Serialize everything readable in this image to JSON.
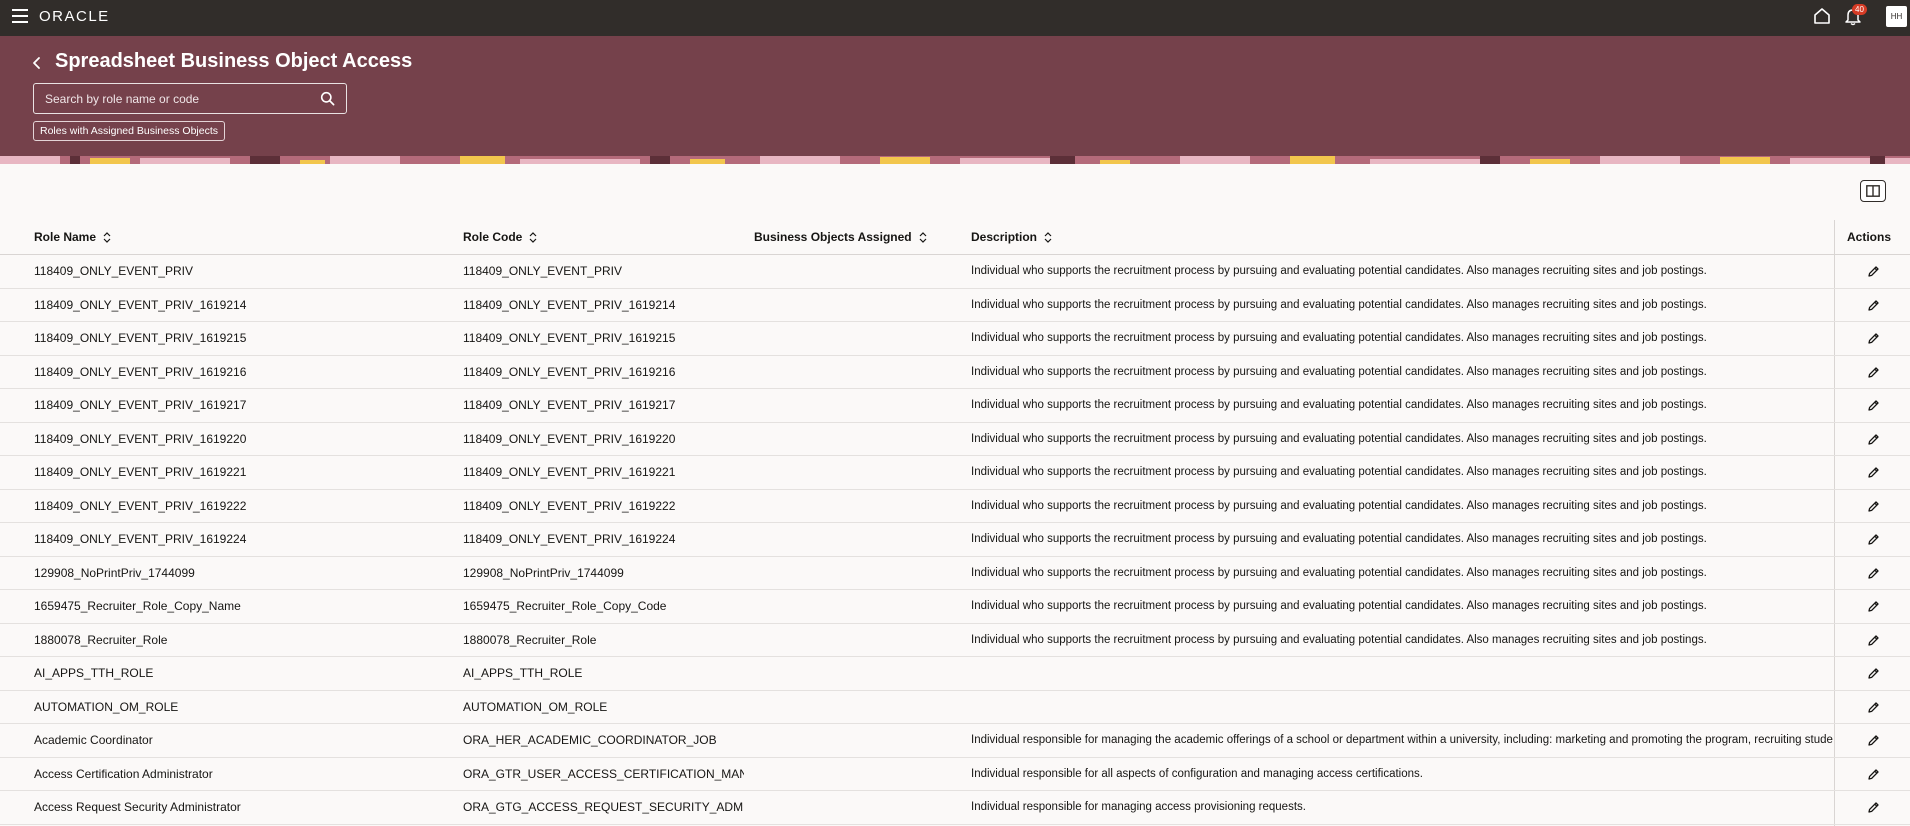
{
  "topbar": {
    "logo": "ORACLE",
    "notification_count": "40",
    "avatar_initials": "HH",
    "icons": [
      "menu-icon",
      "home-icon",
      "bell-icon"
    ]
  },
  "header": {
    "title": "Spreadsheet Business Object Access",
    "search_placeholder": "Search by role name or code",
    "filter_chip": "Roles with Assigned Business Objects"
  },
  "table": {
    "columns": {
      "role_name": "Role Name",
      "role_code": "Role Code",
      "business_objects": "Business Objects Assigned",
      "description": "Description",
      "actions": "Actions"
    },
    "rows": [
      {
        "name": "118409_ONLY_EVENT_PRIV",
        "code": "118409_ONLY_EVENT_PRIV",
        "bo": "",
        "description": "Individual who supports the recruitment process by pursuing and evaluating potential candidates. Also manages recruiting sites and job postings."
      },
      {
        "name": "118409_ONLY_EVENT_PRIV_1619214",
        "code": "118409_ONLY_EVENT_PRIV_1619214",
        "bo": "",
        "description": "Individual who supports the recruitment process by pursuing and evaluating potential candidates. Also manages recruiting sites and job postings."
      },
      {
        "name": "118409_ONLY_EVENT_PRIV_1619215",
        "code": "118409_ONLY_EVENT_PRIV_1619215",
        "bo": "",
        "description": "Individual who supports the recruitment process by pursuing and evaluating potential candidates. Also manages recruiting sites and job postings."
      },
      {
        "name": "118409_ONLY_EVENT_PRIV_1619216",
        "code": "118409_ONLY_EVENT_PRIV_1619216",
        "bo": "",
        "description": "Individual who supports the recruitment process by pursuing and evaluating potential candidates. Also manages recruiting sites and job postings."
      },
      {
        "name": "118409_ONLY_EVENT_PRIV_1619217",
        "code": "118409_ONLY_EVENT_PRIV_1619217",
        "bo": "",
        "description": "Individual who supports the recruitment process by pursuing and evaluating potential candidates. Also manages recruiting sites and job postings."
      },
      {
        "name": "118409_ONLY_EVENT_PRIV_1619220",
        "code": "118409_ONLY_EVENT_PRIV_1619220",
        "bo": "",
        "description": "Individual who supports the recruitment process by pursuing and evaluating potential candidates. Also manages recruiting sites and job postings."
      },
      {
        "name": "118409_ONLY_EVENT_PRIV_1619221",
        "code": "118409_ONLY_EVENT_PRIV_1619221",
        "bo": "",
        "description": "Individual who supports the recruitment process by pursuing and evaluating potential candidates. Also manages recruiting sites and job postings."
      },
      {
        "name": "118409_ONLY_EVENT_PRIV_1619222",
        "code": "118409_ONLY_EVENT_PRIV_1619222",
        "bo": "",
        "description": "Individual who supports the recruitment process by pursuing and evaluating potential candidates. Also manages recruiting sites and job postings."
      },
      {
        "name": "118409_ONLY_EVENT_PRIV_1619224",
        "code": "118409_ONLY_EVENT_PRIV_1619224",
        "bo": "",
        "description": "Individual who supports the recruitment process by pursuing and evaluating potential candidates. Also manages recruiting sites and job postings."
      },
      {
        "name": "129908_NoPrintPriv_1744099",
        "code": "129908_NoPrintPriv_1744099",
        "bo": "",
        "description": "Individual who supports the recruitment process by pursuing and evaluating potential candidates. Also manages recruiting sites and job postings."
      },
      {
        "name": "1659475_Recruiter_Role_Copy_Name",
        "code": "1659475_Recruiter_Role_Copy_Code",
        "bo": "",
        "description": "Individual who supports the recruitment process by pursuing and evaluating potential candidates. Also manages recruiting sites and job postings."
      },
      {
        "name": "1880078_Recruiter_Role",
        "code": "1880078_Recruiter_Role",
        "bo": "",
        "description": "Individual who supports the recruitment process by pursuing and evaluating potential candidates. Also manages recruiting sites and job postings."
      },
      {
        "name": "AI_APPS_TTH_ROLE",
        "code": "AI_APPS_TTH_ROLE",
        "bo": "",
        "description": ""
      },
      {
        "name": "AUTOMATION_OM_ROLE",
        "code": "AUTOMATION_OM_ROLE",
        "bo": "",
        "description": ""
      },
      {
        "name": "Academic Coordinator",
        "code": "ORA_HER_ACADEMIC_COORDINATOR_JOB",
        "bo": "",
        "description": "Individual responsible for managing the academic offerings of a school or department within a university, including: marketing and promoting the program, recruiting stude"
      },
      {
        "name": "Access Certification Administrator",
        "code": "ORA_GTR_USER_ACCESS_CERTIFICATION_MANAGER_",
        "bo": "",
        "description": "Individual responsible for all aspects of configuration and managing access certifications."
      },
      {
        "name": "Access Request Security Administrator",
        "code": "ORA_GTG_ACCESS_REQUEST_SECURITY_ADMINISTRA",
        "bo": "",
        "description": "Individual responsible for managing access provisioning requests."
      }
    ]
  },
  "colors": {
    "topbar": "#312d2a",
    "banner": "#75414b",
    "page_bg": "#fbf9f8",
    "text": "#161513",
    "badge": "#d63b25"
  }
}
